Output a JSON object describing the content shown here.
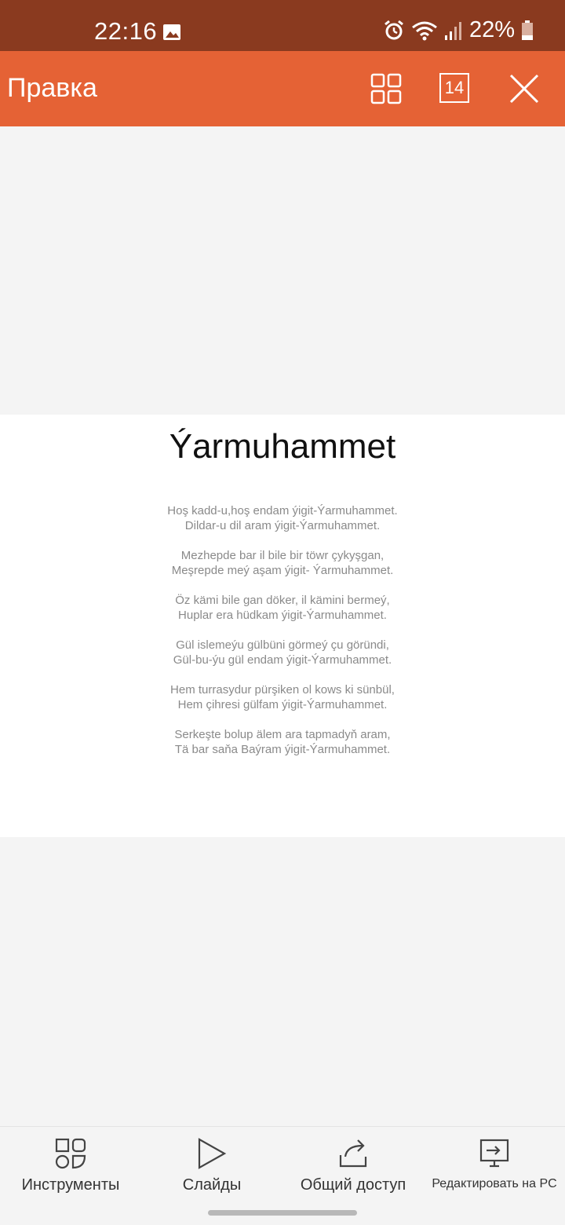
{
  "status_bar": {
    "time": "22:16",
    "battery": "22%",
    "icons": [
      "gallery-icon",
      "alarm-icon",
      "wifi-icon",
      "signal-icon",
      "battery-icon"
    ]
  },
  "toolbar": {
    "title": "Правка",
    "slide_count": "14",
    "icons": [
      "grid-icon",
      "slide-count-icon",
      "close-icon"
    ]
  },
  "slide": {
    "title": "Ýarmuhammet",
    "stanzas": [
      [
        "Hoş kadd-u,hoş endam ýigit-Ýarmuhammet.",
        "Dildar-u dil aram ýigit-Ýarmuhammet."
      ],
      [
        "Mezhepde bar il bile bir töwr çykyşgan,",
        "Meşrepde meý aşam ýigit- Ýarmuhammet."
      ],
      [
        "Öz kämi bile gan döker, il kämini bermeý,",
        "Huplar era hüdkam ýigit-Ýarmuhammet."
      ],
      [
        "Gül islemeýu gülbüni görmeý çu göründi,",
        "Gül-bu-ýu gül endam ýigit-Ýarmuhammet."
      ],
      [
        "Hem turrasydur pürşiken ol kows ki sünbül,",
        "Hem çihresi gülfam ýigit-Ýarmuhammet."
      ],
      [
        "Serkeşte bolup älem ara tapmadyň aram,",
        "Tä bar saňa Baýram ýigit-Ýarmuhammet."
      ]
    ]
  },
  "bottom_nav": {
    "tools": "Инструменты",
    "slides": "Слайды",
    "share": "Общий доступ",
    "edit_on_pc": "Редактировать на PC"
  },
  "colors": {
    "status_bar": "#8a3a1f",
    "toolbar": "#e56235",
    "slide_bg": "#ffffff",
    "canvas_bg": "#f4f4f4"
  }
}
